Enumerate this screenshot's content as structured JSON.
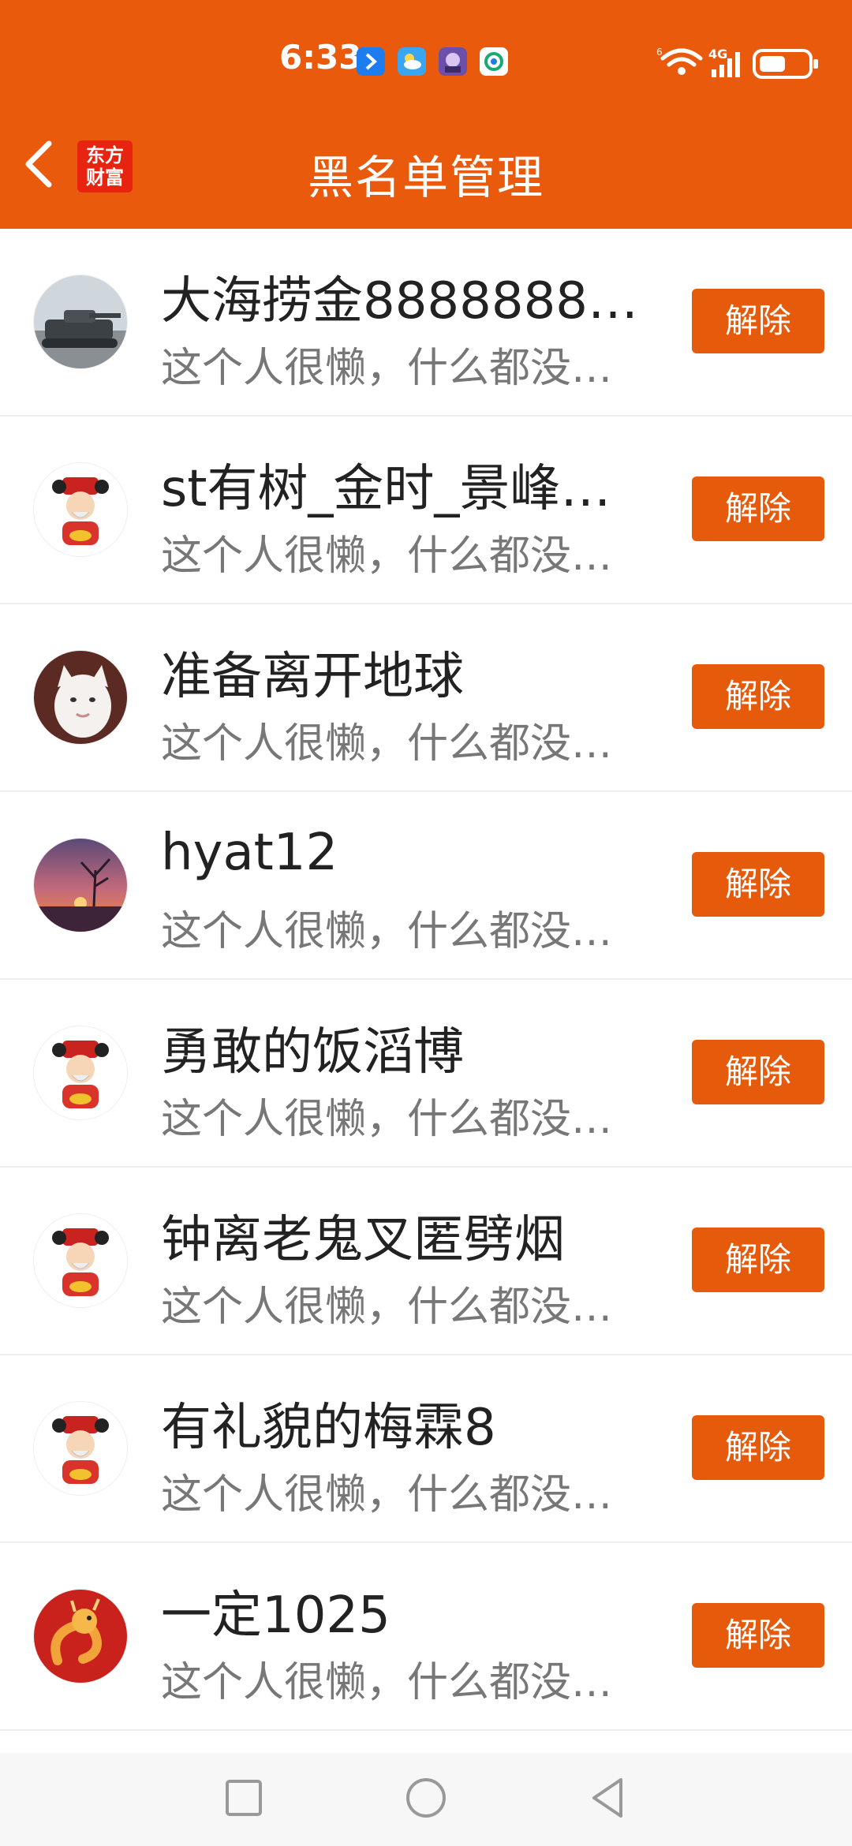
{
  "status_bar": {
    "time": "6:33",
    "icons": [
      "bluetooth-app-icon",
      "weather-icon",
      "game-icon",
      "mobile-app-icon"
    ],
    "right_icons": [
      "wifi-icon",
      "4g-signal-icon",
      "battery-icon"
    ]
  },
  "header": {
    "back_icon": "chevron-left-icon",
    "logo_line1": "东方",
    "logo_line2": "财富",
    "title": "黑名单管理"
  },
  "accent_color": "#ea5a0c",
  "blocklist": [
    {
      "name": "大海捞金8888888…",
      "bio": "这个人很懒，什么都没…",
      "avatar": "tank-photo",
      "action": "解除"
    },
    {
      "name": "st有树_金时_景峰…",
      "bio": "这个人很懒，什么都没…",
      "avatar": "fortune-god",
      "action": "解除"
    },
    {
      "name": "准备离开地球",
      "bio": "这个人很懒，什么都没…",
      "avatar": "cat-photo",
      "action": "解除"
    },
    {
      "name": "hyat12",
      "bio": "这个人很懒，什么都没…",
      "avatar": "sunset-photo",
      "action": "解除"
    },
    {
      "name": "勇敢的饭滔博",
      "bio": "这个人很懒，什么都没…",
      "avatar": "fortune-god",
      "action": "解除"
    },
    {
      "name": "钟离老鬼叉匿劈烟",
      "bio": "这个人很懒，什么都没…",
      "avatar": "fortune-god",
      "action": "解除"
    },
    {
      "name": "有礼貌的梅霖8",
      "bio": "这个人很懒，什么都没…",
      "avatar": "fortune-god",
      "action": "解除"
    },
    {
      "name": "一定1025",
      "bio": "这个人很懒，什么都没…",
      "avatar": "dragon-art",
      "action": "解除"
    }
  ],
  "nav_bar": {
    "buttons": [
      "recents-square-icon",
      "home-circle-icon",
      "back-triangle-icon"
    ]
  }
}
